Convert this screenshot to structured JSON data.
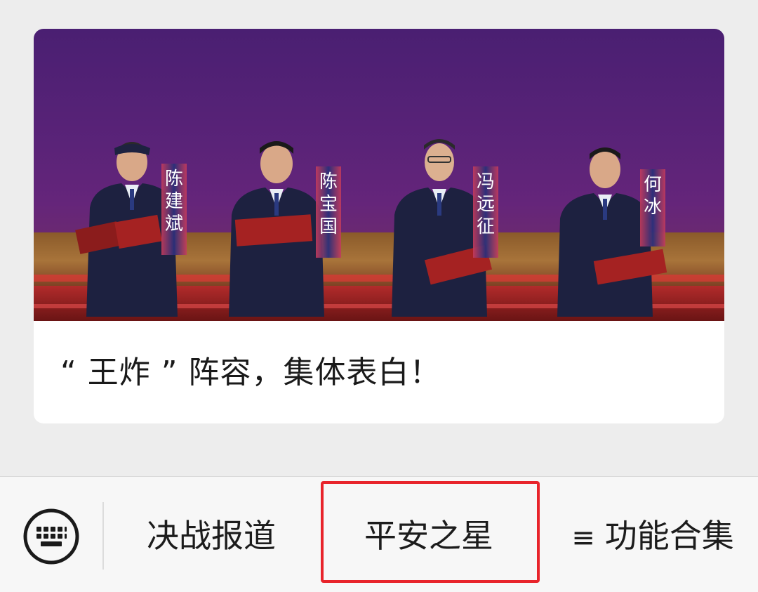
{
  "article": {
    "title": "“ 王炸 ” 阵容，集体表白！",
    "cover_name_tags": [
      "陈建斌",
      "陈宝国",
      "冯远征",
      "何冰"
    ]
  },
  "menu": {
    "items": [
      {
        "label": "决战报道"
      },
      {
        "label": "平安之星",
        "highlighted": true
      },
      {
        "label": "功能合集",
        "icon": "hamburger-icon"
      }
    ],
    "keyboard_icon": "keyboard-icon",
    "menu_glyph": "≡"
  },
  "colors": {
    "highlight": "#e8242b",
    "stage_purple": "#5a2378",
    "stage_red": "#c0262c"
  }
}
